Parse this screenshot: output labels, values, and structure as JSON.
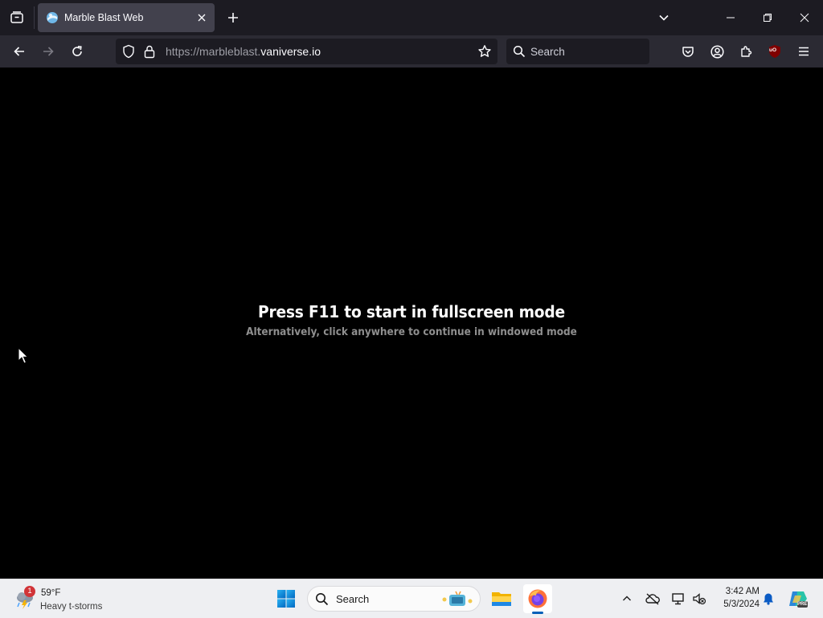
{
  "browser": {
    "tab": {
      "title": "Marble Blast Web"
    },
    "url": {
      "prefix": "https://marbleblast.",
      "domain": "vaniverse.io"
    },
    "search_placeholder": "Search",
    "extension_badge": "uO"
  },
  "page": {
    "headline": "Press F11 to start in fullscreen mode",
    "subline": "Alternatively, click anywhere to continue in windowed mode"
  },
  "taskbar": {
    "weather": {
      "temperature": "59°F",
      "condition": "Heavy t-storms",
      "badge": "1"
    },
    "search_label": "Search",
    "clock": {
      "time": "3:42 AM",
      "date": "5/3/2024"
    }
  },
  "colors": {
    "tab_bg": "#42414d",
    "toolbar_bg": "#2b2a33",
    "tabstrip_bg": "#1c1b22",
    "taskbar_bg": "#eeeff2",
    "accent_blue": "#005fb8"
  },
  "icons": {
    "list_all_tabs": "tab-tray-icon",
    "close_tab": "close-icon",
    "new_tab": "plus-icon",
    "back": "arrow-left-icon",
    "forward": "arrow-right-icon",
    "reload": "reload-icon",
    "bookmark": "star-icon",
    "pocket": "pocket-icon",
    "account": "account-icon",
    "extensions": "puzzle-icon",
    "menu": "hamburger-icon"
  }
}
